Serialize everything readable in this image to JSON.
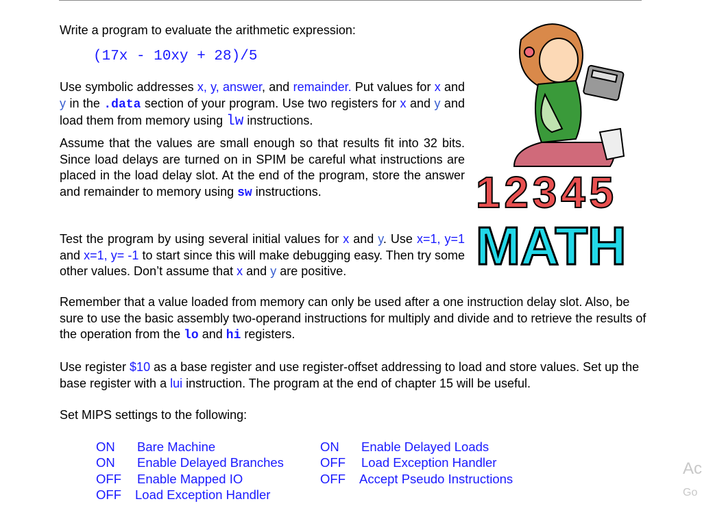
{
  "intro": "Write a program to evaluate the arithmetic expression:",
  "expression": "(17x - 10xy + 28)/5",
  "para1": {
    "t1": "Use symbolic addresses ",
    "sym": "x, y, answer",
    "t2": ", and ",
    "rem": "remainder.",
    "t3": "  Put values for ",
    "x": "x",
    "t4": " and  ",
    "y": "y",
    "t5": " in the ",
    "data": ".data",
    "t6": " section of your program.  Use two registers for ",
    "t7": " and ",
    "t8": " and load them from memory using ",
    "lw": "lw",
    "t9": " instructions."
  },
  "para2": {
    "t1": "Assume that the values are small enough so that results fit into 32 bits. Since load delays are turned on in SPIM be careful what instructions are placed in the load delay slot. At the end of the program, store the answer and remainder to memory using ",
    "sw": "sw",
    "t2": " instructions."
  },
  "para3": {
    "t1": "Test the program by using several initial values for ",
    "x": "x",
    "t2": " and ",
    "y": "y",
    "t3": ". Use ",
    "v1": "x=1, y=1",
    "t4": " and ",
    "v2": "x=1, y= -1",
    "t5": " to start since this will make debugging easy. Then try some other values. Don’t assume that ",
    "t6": " are positive."
  },
  "para4": {
    "t1": "Remember that a value loaded from memory can only be used after a one instruction delay slot. Also, be sure to use the basic assembly two-operand instructions for multiply and divide and to retrieve the results of the operation from the ",
    "lo": "lo",
    "t2": " and ",
    "hi": "hi",
    "t3": " registers."
  },
  "para5": {
    "t1": "Use register ",
    "reg": "$10",
    "t2": " as a base register and use register-offset addressing to load and store values. Set up the base register with a ",
    "lui": "lui",
    "t3": " instruction. The program at the end of chapter 15 will be useful."
  },
  "settings_intro": "Set MIPS settings to the following:",
  "settings_left": [
    {
      "state": "ON",
      "label": "Bare Machine"
    },
    {
      "state": "ON",
      "label": "Enable Delayed Branches"
    },
    {
      "state": "OFF",
      "label": "Enable Mapped IO"
    },
    {
      "state": "OFF",
      "label": "Load Exception Handler"
    }
  ],
  "settings_right": [
    {
      "state": "ON",
      "label": "Enable Delayed Loads"
    },
    {
      "state": "OFF",
      "label": "Load Exception Handler"
    },
    {
      "state": "OFF",
      "label": "Accept Pseudo Instructions"
    }
  ],
  "watermark": {
    "line1": "Ac",
    "line2": "Go"
  },
  "clipart": {
    "lettering": "MATH",
    "numbers": "1 2 3 4 5"
  },
  "colors": {
    "link_blue": "#1a1aff",
    "math_cyan": "#22d8e8"
  }
}
